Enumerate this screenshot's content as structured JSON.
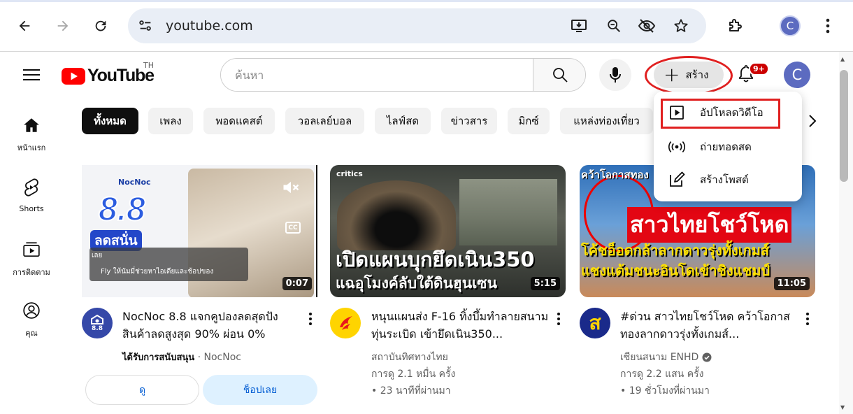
{
  "browser": {
    "url": "youtube.com",
    "profile_initial": "C"
  },
  "header": {
    "logo_text": "YouTube",
    "country": "TH",
    "search_placeholder": "ค้นหา",
    "create_label": "สร้าง",
    "notification_count": "9+",
    "avatar_initial": "C"
  },
  "sidebar": {
    "items": [
      {
        "label": "หน้าแรก",
        "icon": "home-icon"
      },
      {
        "label": "Shorts",
        "icon": "shorts-icon"
      },
      {
        "label": "การติดตาม",
        "icon": "subscriptions-icon"
      },
      {
        "label": "คุณ",
        "icon": "you-icon"
      }
    ]
  },
  "chips": [
    "ทั้งหมด",
    "เพลง",
    "พอดแคสต์",
    "วอลเลย์บอล",
    "ไลฟ์สด",
    "ข่าวสาร",
    "มิกซ์",
    "แหล่งท่องเที่ยว"
  ],
  "create_menu": {
    "items": [
      {
        "label": "อัปโหลดวิดีโอ",
        "icon": "upload-video-icon"
      },
      {
        "label": "ถ่ายทอดสด",
        "icon": "live-icon"
      },
      {
        "label": "สร้างโพสต์",
        "icon": "create-post-icon"
      }
    ]
  },
  "videos": [
    {
      "title": "NocNoc 8.8 แจกคูปองลดสุดปัง สินค้าลดสูงสุด 90% ผ่อน 0%",
      "meta1_strong": "ได้รับการสนับสนุน",
      "meta1_rest": " · NocNoc",
      "duration": "0:07",
      "thumb_brand": "NocNoc",
      "thumb_big": "8.8",
      "thumb_sale": "ลดสนั่น",
      "thumb_caption_label": "เลย",
      "thumb_caption": "Fly ให้นัมมี่ช่วยหาไอเดียและช้อปของ",
      "cc": "CC",
      "avatar_text": "8.8",
      "btn_view": "ดู",
      "btn_shop": "ช็อปเลย"
    },
    {
      "title": "หนุนแผนส่ง F-16 ทิ้งบึ้มทำลายสนามทุ่นระเบิด เข้ายึดเนิน350...",
      "channel": "สถาบันทิศทางไทย",
      "views": "การดู 2.1 หมื่น ครั้ง",
      "age": "• 23 นาทีที่ผ่านมา",
      "duration": "5:15",
      "thumb_logo": "critics",
      "thumb_line1": "เปิดแผนบุกยึดเนิน350",
      "thumb_line2": "แฉอุโมงค์ลับใต้ดินฮุนเซน"
    },
    {
      "title": "#ด่วน สาวไทยโชว์โหด คว้าโอกาสทองลากดาวรุ่งทั้งเกมส์...",
      "channel": "เซียนสนาม ENHD",
      "views": "การดู 2.2 แสน ครั้ง",
      "age": "• 19 ชั่วโมงที่ผ่านมา",
      "duration": "11:05",
      "thumb_top": "คว้าโอกาสทอง",
      "thumb_line1": "สาวไทยโชว์โหด",
      "thumb_line2": "โค้ชอ็อดกล้าลากดาวรุ่งทั้งเกมส์",
      "thumb_line3": "แชงแต้มชนะอินโดเข้าชิงแชมป์"
    }
  ],
  "colors": {
    "yt_red": "#ff0000",
    "highlight_red": "#e02020",
    "avatar_blue": "#5c6bc0"
  }
}
